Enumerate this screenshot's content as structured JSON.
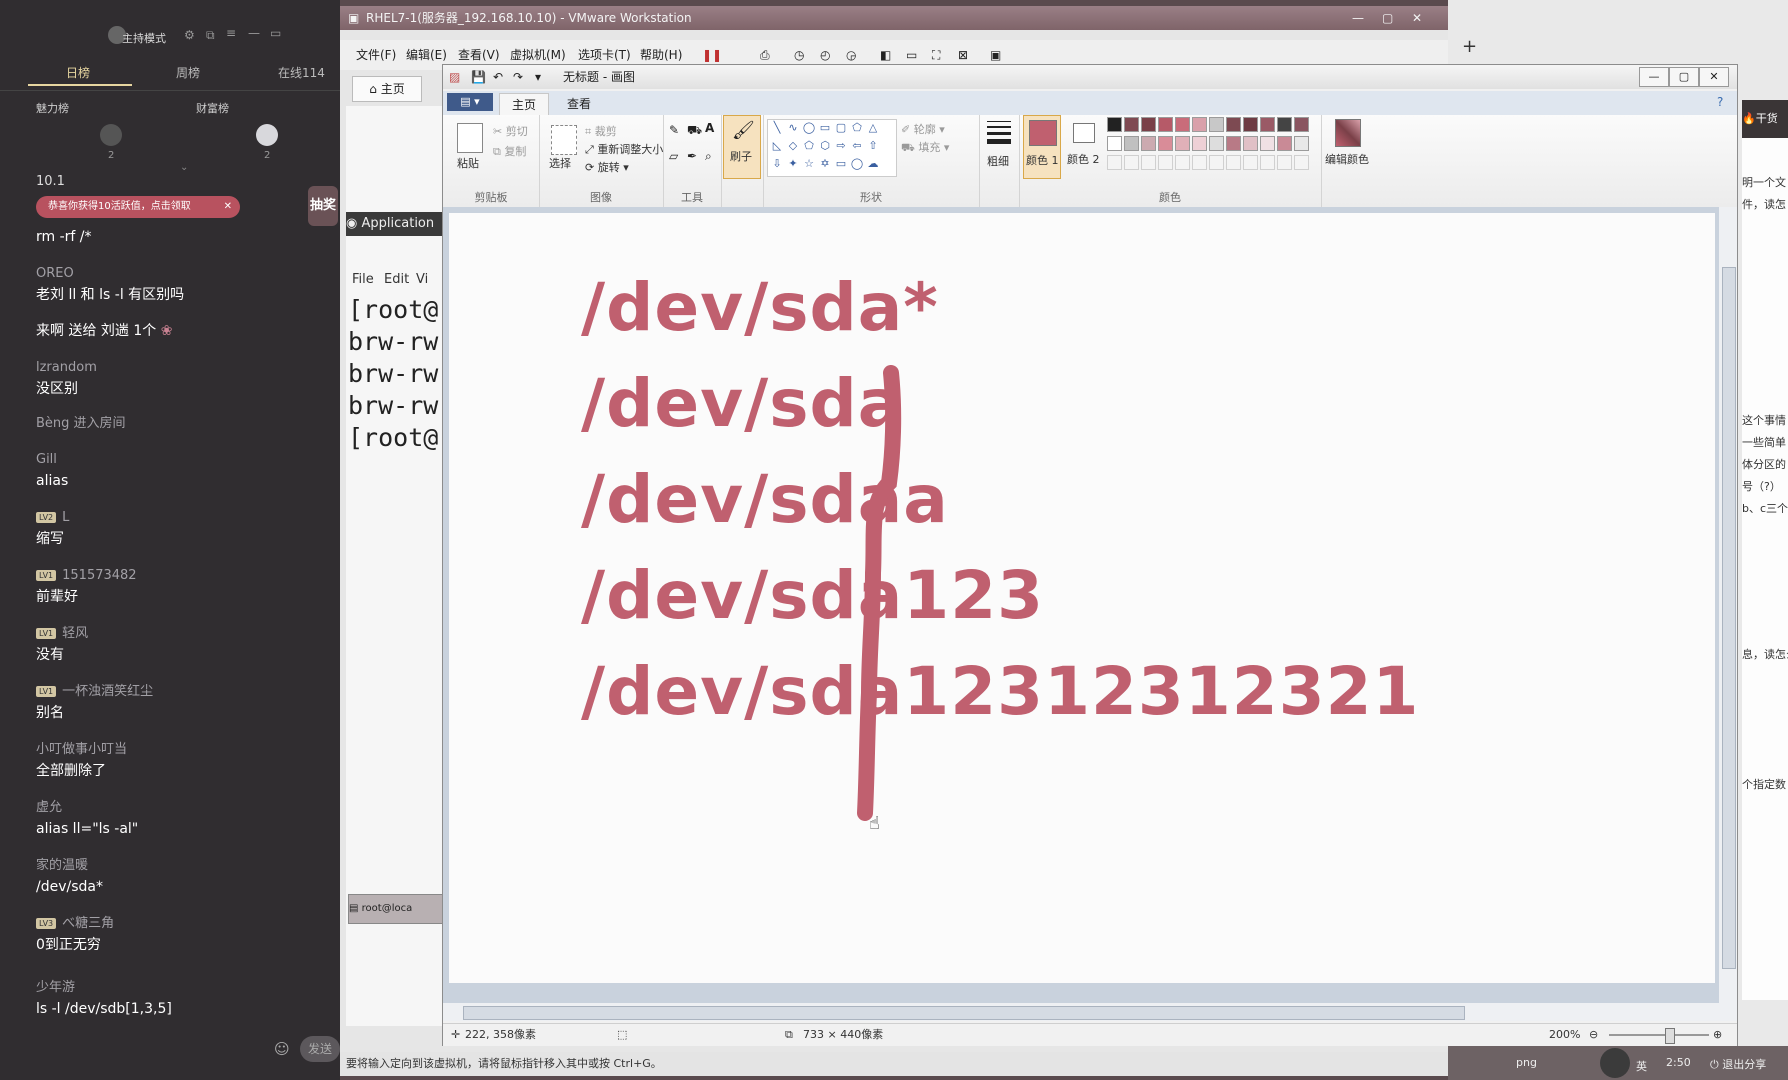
{
  "chat": {
    "mode_label": "主持模式",
    "tabs": [
      "日榜",
      "周榜",
      "在线114"
    ],
    "ranks": [
      {
        "label": "魅力榜",
        "count": "2"
      },
      {
        "label": "财富榜",
        "count": "2"
      }
    ],
    "partial_top": "10.1",
    "banner": "恭喜你获得10活跃值，点击领取",
    "banner_close": "✕",
    "side_badge": "抽奖",
    "send_label": "发送",
    "messages": [
      {
        "name": "",
        "text": "rm -rf /*",
        "level": ""
      },
      {
        "name": "OREO",
        "text": "老刘   ll  和 ls -l 有区别吗",
        "level": ""
      },
      {
        "name": "",
        "text": "来啊 送给 刘遄 1个",
        "level": ""
      },
      {
        "name": "lzrandom",
        "text": "没区别",
        "level": ""
      },
      {
        "name": "Bèng 进入房间",
        "text": "",
        "level": ""
      },
      {
        "name": "Gill",
        "text": "alias",
        "level": ""
      },
      {
        "name": "L",
        "text": "缩写",
        "level": "LV2"
      },
      {
        "name": "151573482",
        "text": "前辈好",
        "level": "LV1"
      },
      {
        "name": "轻风",
        "text": "没有",
        "level": "LV1"
      },
      {
        "name": "一杯浊酒笑红尘",
        "text": "别名",
        "level": "LV1"
      },
      {
        "name": "小叮做事小叮当",
        "text": "全部删除了",
        "level": ""
      },
      {
        "name": "虚允",
        "text": "alias ll=\"ls -al\"",
        "level": ""
      },
      {
        "name": "家的温暖",
        "text": "/dev/sda*",
        "level": ""
      },
      {
        "name": "べ糖三角",
        "text": "0到正无穷",
        "level": "LV3"
      },
      {
        "name": "少年游",
        "text": "ls -l /dev/sdb[1,3,5]",
        "level": ""
      }
    ]
  },
  "vmware": {
    "title": "RHEL7-1(服务器_192.168.10.10) - VMware Workstation",
    "menu": [
      "文件(F)",
      "编辑(E)",
      "查看(V)",
      "虚拟机(M)",
      "选项卡(T)",
      "帮助(H)"
    ],
    "home_tab": "主页",
    "app_bar": "Application",
    "term_menu": [
      "File",
      "Edit",
      "Vi"
    ],
    "terminal_lines": [
      "[root@",
      "brw-rw",
      "brw-rw",
      "brw-rw",
      "[root@"
    ],
    "taskbar_item": "root@loca",
    "status": "要将输入定向到该虚拟机，请将鼠标指针移入其中或按 Ctrl+G。"
  },
  "paint": {
    "title": "无标题 - 画图",
    "tabs": [
      "主页",
      "查看"
    ],
    "ribbon": {
      "paste": "粘贴",
      "cut": "剪切",
      "copy": "复制",
      "clipboard_group": "剪贴板",
      "select": "选择",
      "crop": "裁剪",
      "resize": "重新调整大小",
      "rotate": "旋转",
      "image_group": "图像",
      "tools_group": "工具",
      "brushes": "刷子",
      "shapes_group": "形状",
      "outline": "轮廓",
      "fill": "填充",
      "size": "粗细",
      "color1": "颜色 1",
      "color2": "颜色 2",
      "colors_group": "颜色",
      "edit_colors": "编辑颜色",
      "color1_hex": "#c0606f",
      "color2_hex": "#ffffff",
      "palette": [
        "#222222",
        "#7f4a52",
        "#7a4048",
        "#b65a68",
        "#c96c7a",
        "#d9a0aa",
        "#c8c8c8",
        "#7d4a52",
        "#6e3b43",
        "#9a5a66",
        "#444444",
        "#8a5560",
        "#ffffff",
        "#c0c0c0",
        "#ccaab0",
        "#d98c98",
        "#e0b0b8",
        "#eed0d6",
        "#dddddd",
        "#b87a86",
        "#e0c0c6",
        "#f0e0e4",
        "#c98a96",
        "#e8e8e8"
      ]
    },
    "canvas_lines": [
      "/dev/sda*",
      "/dev/sda",
      "/dev/sdaa",
      "/dev/sda123",
      "/dev/sda12312312321"
    ],
    "status": {
      "cursor_pos": "222, 358像素",
      "canvas_size": "733 × 440像素",
      "zoom": "200%"
    }
  },
  "right_panel": {
    "header": "干货",
    "snippets": [
      "明一个文",
      "件，读怎",
      "这个事情",
      "一些简单",
      "体分区的",
      "号（?）",
      "b、c三个",
      "息，读怎么",
      "个指定数"
    ]
  },
  "tray": {
    "ime": "英",
    "clock": "2:50",
    "share": "退出分享",
    "file_ext": "png"
  }
}
